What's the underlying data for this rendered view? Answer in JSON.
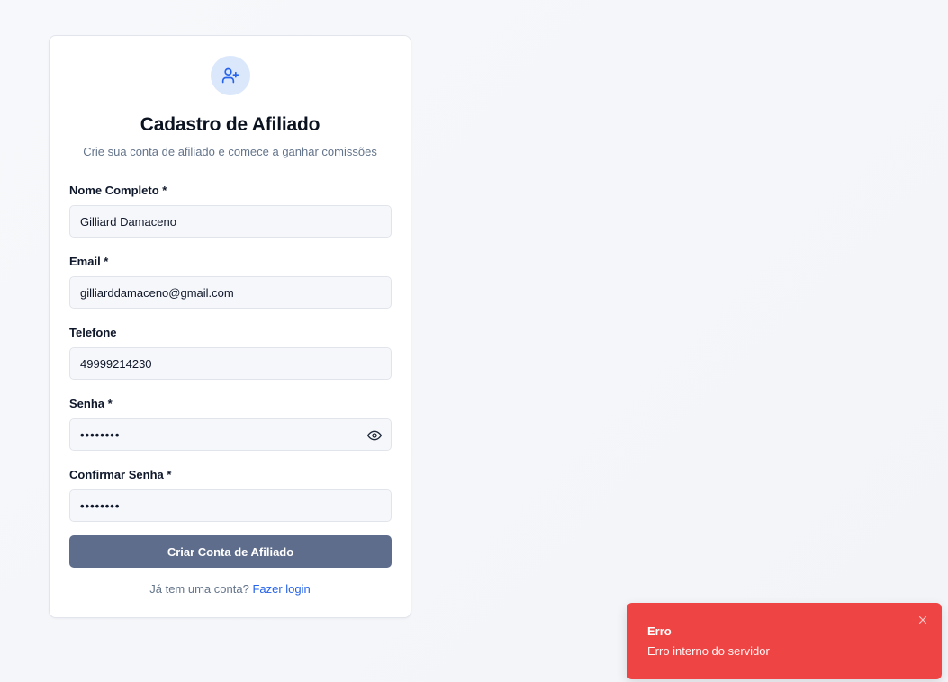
{
  "form": {
    "title": "Cadastro de Afiliado",
    "subtitle": "Crie sua conta de afiliado e comece a ganhar comissões",
    "icon": "user-plus-icon",
    "fields": {
      "name": {
        "label": "Nome Completo *",
        "value": "Gilliard Damaceno"
      },
      "email": {
        "label": "Email *",
        "value": "gilliarddamaceno@gmail.com"
      },
      "phone": {
        "label": "Telefone",
        "value": "49999214230"
      },
      "password": {
        "label": "Senha *",
        "value": "••••••••",
        "toggle_icon": "eye-icon"
      },
      "confirm_password": {
        "label": "Confirmar Senha *",
        "value": "••••••••"
      }
    },
    "submit_label": "Criar Conta de Afiliado",
    "login_prompt": "Já tem uma conta?",
    "login_link": "Fazer login"
  },
  "toast": {
    "title": "Erro",
    "message": "Erro interno do servidor",
    "close_icon": "close-icon"
  },
  "colors": {
    "accent": "#2563eb",
    "button": "#5f6d8c",
    "toast_error": "#ef4444",
    "icon_bg": "#dbe7fb"
  }
}
